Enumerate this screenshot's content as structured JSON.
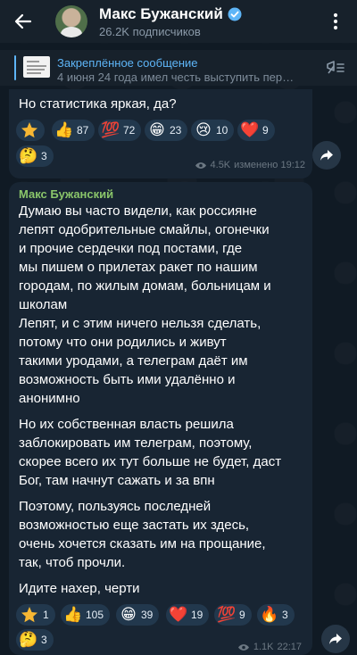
{
  "header": {
    "title": "Макс Бужанский",
    "subtitle": "26.2K подписчиков",
    "back_icon": "arrow-left-icon",
    "menu_icon": "more-vertical-icon",
    "verified_icon": "verified-badge-icon"
  },
  "pinned": {
    "title": "Закреплённое сообщение",
    "text": "4 июня 24 года имел честь выступить пер…"
  },
  "message1": {
    "text": "Но статистика яркая, да?",
    "reactions": [
      {
        "emoji": "⭐",
        "count": ""
      },
      {
        "emoji": "👍",
        "count": "87"
      },
      {
        "emoji": "💯",
        "count": "72"
      },
      {
        "emoji": "😁",
        "count": "23"
      },
      {
        "emoji": "😢",
        "count": "10"
      },
      {
        "emoji": "❤️",
        "count": "9"
      },
      {
        "emoji": "🤔",
        "count": "3"
      }
    ],
    "views": "4.5K",
    "time": "изменено 19:12"
  },
  "message2": {
    "author": "Макс Бужанский",
    "paragraphs": [
      "Думаю вы часто видели, как россияне\nлепят одобрительные смайлы, огонечки\nи прочие сердечки под постами, где\nмы пишем о прилетах ракет по нашим\nгородам, по жилым домам, больницам и\nшколам",
      "Лепят, и с этим ничего нельзя сделать,\nпотому что они родились и живут\nтакими уродами, а телеграм даёт им\nвозможность быть ими удалённо и\nанонимно",
      "Но их собственная власть решила\nзаблокировать им телеграм, поэтому,\nскорее всего их тут больше не будет, даст\nБог, там начнут сажать и за впн",
      "Поэтому, пользуясь последней\nвозможностью еще застать их здесь,\nочень хочется сказать им на прощание,\nтак, чтоб прочли.",
      "Идите нахер, черти"
    ],
    "reactions": [
      {
        "emoji": "⭐",
        "count": "1"
      },
      {
        "emoji": "👍",
        "count": "105"
      },
      {
        "emoji": "😁",
        "count": "39"
      },
      {
        "emoji": "❤️",
        "count": "19"
      },
      {
        "emoji": "💯",
        "count": "9"
      },
      {
        "emoji": "🔥",
        "count": "3"
      },
      {
        "emoji": "🤔",
        "count": "3"
      }
    ],
    "views": "1.1K",
    "time": "22:17"
  },
  "colors": {
    "header_bg": "#17212b",
    "bubble_bg": "#182533",
    "accent_blue": "#5eb5f7",
    "author_green": "#8ac56a",
    "reaction_bg": "#22384d"
  }
}
